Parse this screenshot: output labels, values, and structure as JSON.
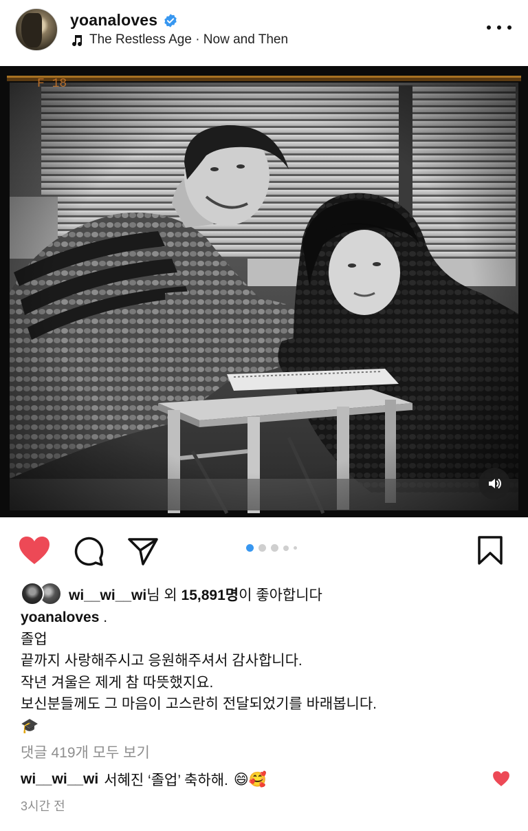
{
  "post": {
    "username": "yoanaloves",
    "music": "The Restless Age · Now and Then",
    "icons": {
      "verified": "verified-badge-icon",
      "music": "music-note-icon",
      "more": "more-options-icon",
      "sound": "speaker-icon",
      "like": "heart-filled-icon",
      "comment": "comment-icon",
      "share": "paper-plane-icon",
      "save": "bookmark-icon"
    },
    "photo": {
      "overlay_frame": "F 18"
    },
    "carousel": {
      "count": 5,
      "active": 1
    },
    "likes": {
      "liker": "wi__wi__wi",
      "suffix_1": "님 외 ",
      "count": "15,891명",
      "suffix_2": "이 좋아합니다"
    },
    "caption": {
      "username": "yoanaloves",
      "first": " .",
      "lines": [
        "졸업",
        "끝까지 사랑해주시고 응원해주셔서 감사합니다.",
        "작년 겨울은 제게 참 따뜻했지요.",
        "보신분들께도 그 마음이 고스란히 전달되었기를 바래봅니다.",
        "🎓"
      ]
    },
    "view_comments": "댓글 419개 모두 보기",
    "comment": {
      "username": "wi__wi__wi",
      "text": "서혜진 ‘졸업’ 축하해.",
      "emoji": "😄🥰"
    },
    "timestamp": "3시간 전",
    "colors": {
      "like_red": "#ed4956",
      "accent_blue": "#3897f0",
      "verified_blue": "#3897f0",
      "muted_gray": "#8e8e8e"
    }
  }
}
